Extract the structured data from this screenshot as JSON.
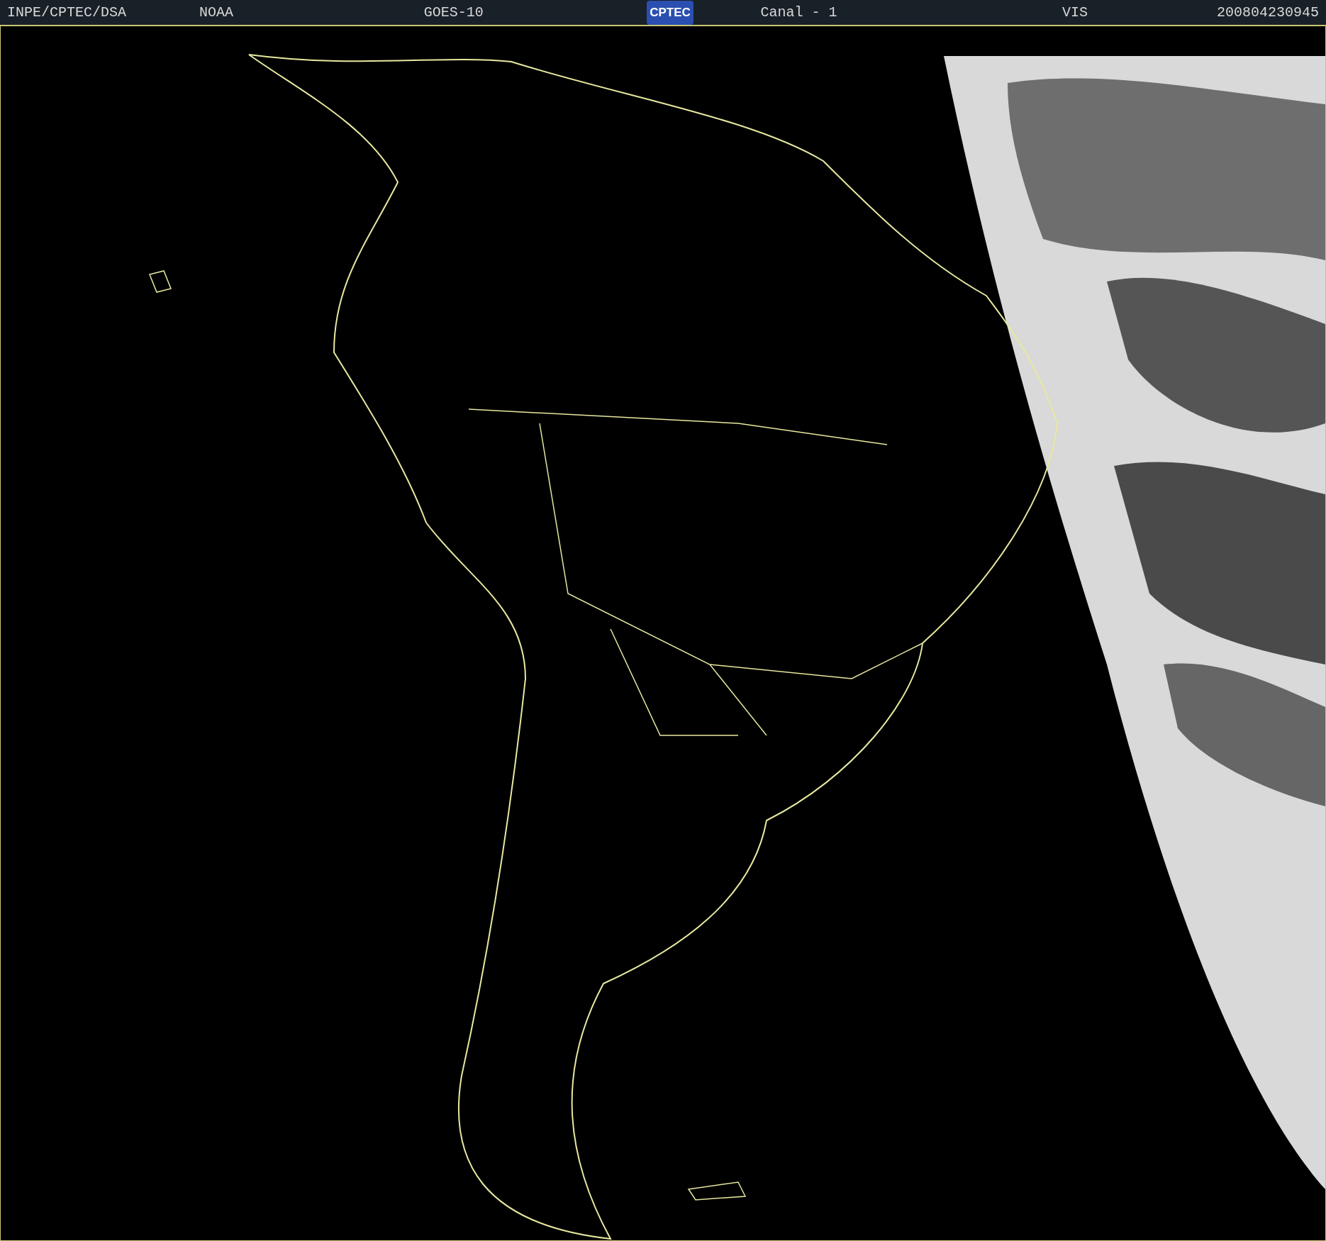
{
  "header": {
    "items": [
      {
        "kind": "text",
        "text": "INPE/CPTEC/DSA"
      },
      {
        "kind": "text",
        "text": "NOAA"
      },
      {
        "kind": "text",
        "text": "GOES-10"
      },
      {
        "kind": "logo",
        "text": "CPTEC"
      },
      {
        "kind": "text",
        "text": "Canal - 1"
      },
      {
        "kind": "text",
        "text": "VIS"
      },
      {
        "kind": "text",
        "text": "200804230945"
      }
    ]
  }
}
